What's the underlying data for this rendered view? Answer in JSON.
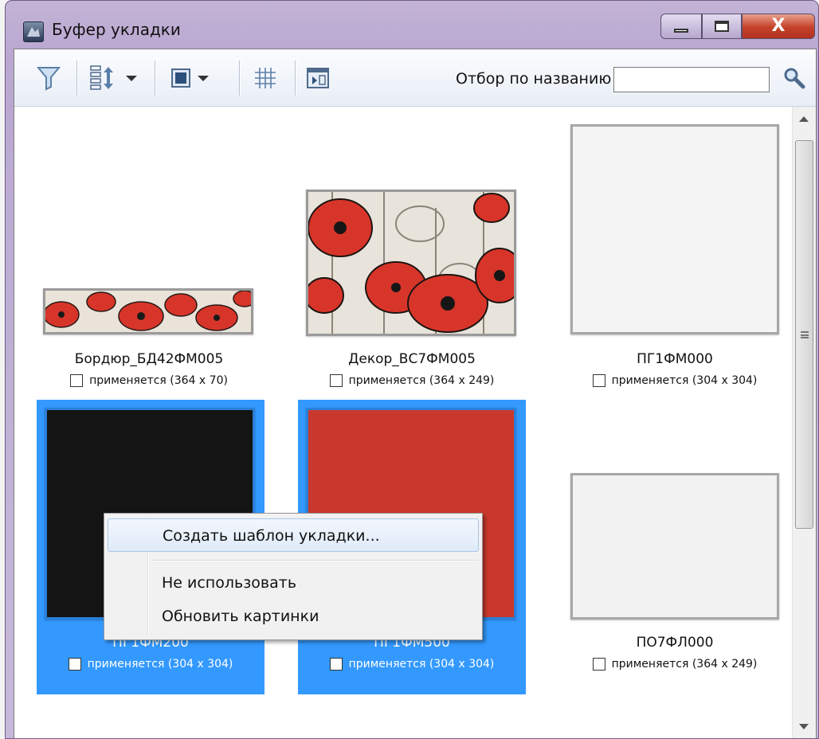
{
  "window": {
    "title": "Буфер укладки",
    "icon": "app-icon",
    "controls": [
      "minimize-icon",
      "maximize-icon",
      "close-icon"
    ],
    "close_glyph": "X"
  },
  "toolbar": {
    "icons": [
      "filter-icon",
      "sort-icon",
      "view-mode-icon",
      "grid-icon",
      "apply-layout-icon",
      "search-icon"
    ],
    "filter_label": "Отбор по названию",
    "filter_value": ""
  },
  "tiles": [
    {
      "name": "Бордюр_БД42ФМ005",
      "info": "применяется (364 x 70)",
      "checked": false,
      "selected": false,
      "pattern": "poppy"
    },
    {
      "name": "Декор_ВС7ФМ005",
      "info": "применяется (364 x 249)",
      "checked": false,
      "selected": false,
      "pattern": "poppy"
    },
    {
      "name": "ПГ1ФМ000",
      "info": "применяется (304 x 304)",
      "checked": false,
      "selected": false,
      "pattern": "white"
    },
    {
      "name": "ПГ1ФМ200",
      "info": "применяется (304 x 304)",
      "checked": false,
      "selected": true,
      "pattern": "black"
    },
    {
      "name": "ПГ1ФМ500",
      "info": "применяется (304 x 304)",
      "checked": false,
      "selected": true,
      "pattern": "red"
    },
    {
      "name": "ПО7ФЛ000",
      "info": "применяется (364 x 249)",
      "checked": false,
      "selected": false,
      "pattern": "white"
    }
  ],
  "context_menu": {
    "items": [
      {
        "label": "Создать шаблон укладки..."
      },
      {
        "label": "Не использовать"
      },
      {
        "label": "Обновить картинки"
      }
    ]
  },
  "colors": {
    "selection": "#3399ff",
    "title_bar": "#b9a7d0",
    "tile_red": "#c9382c",
    "tile_black": "#141414"
  }
}
